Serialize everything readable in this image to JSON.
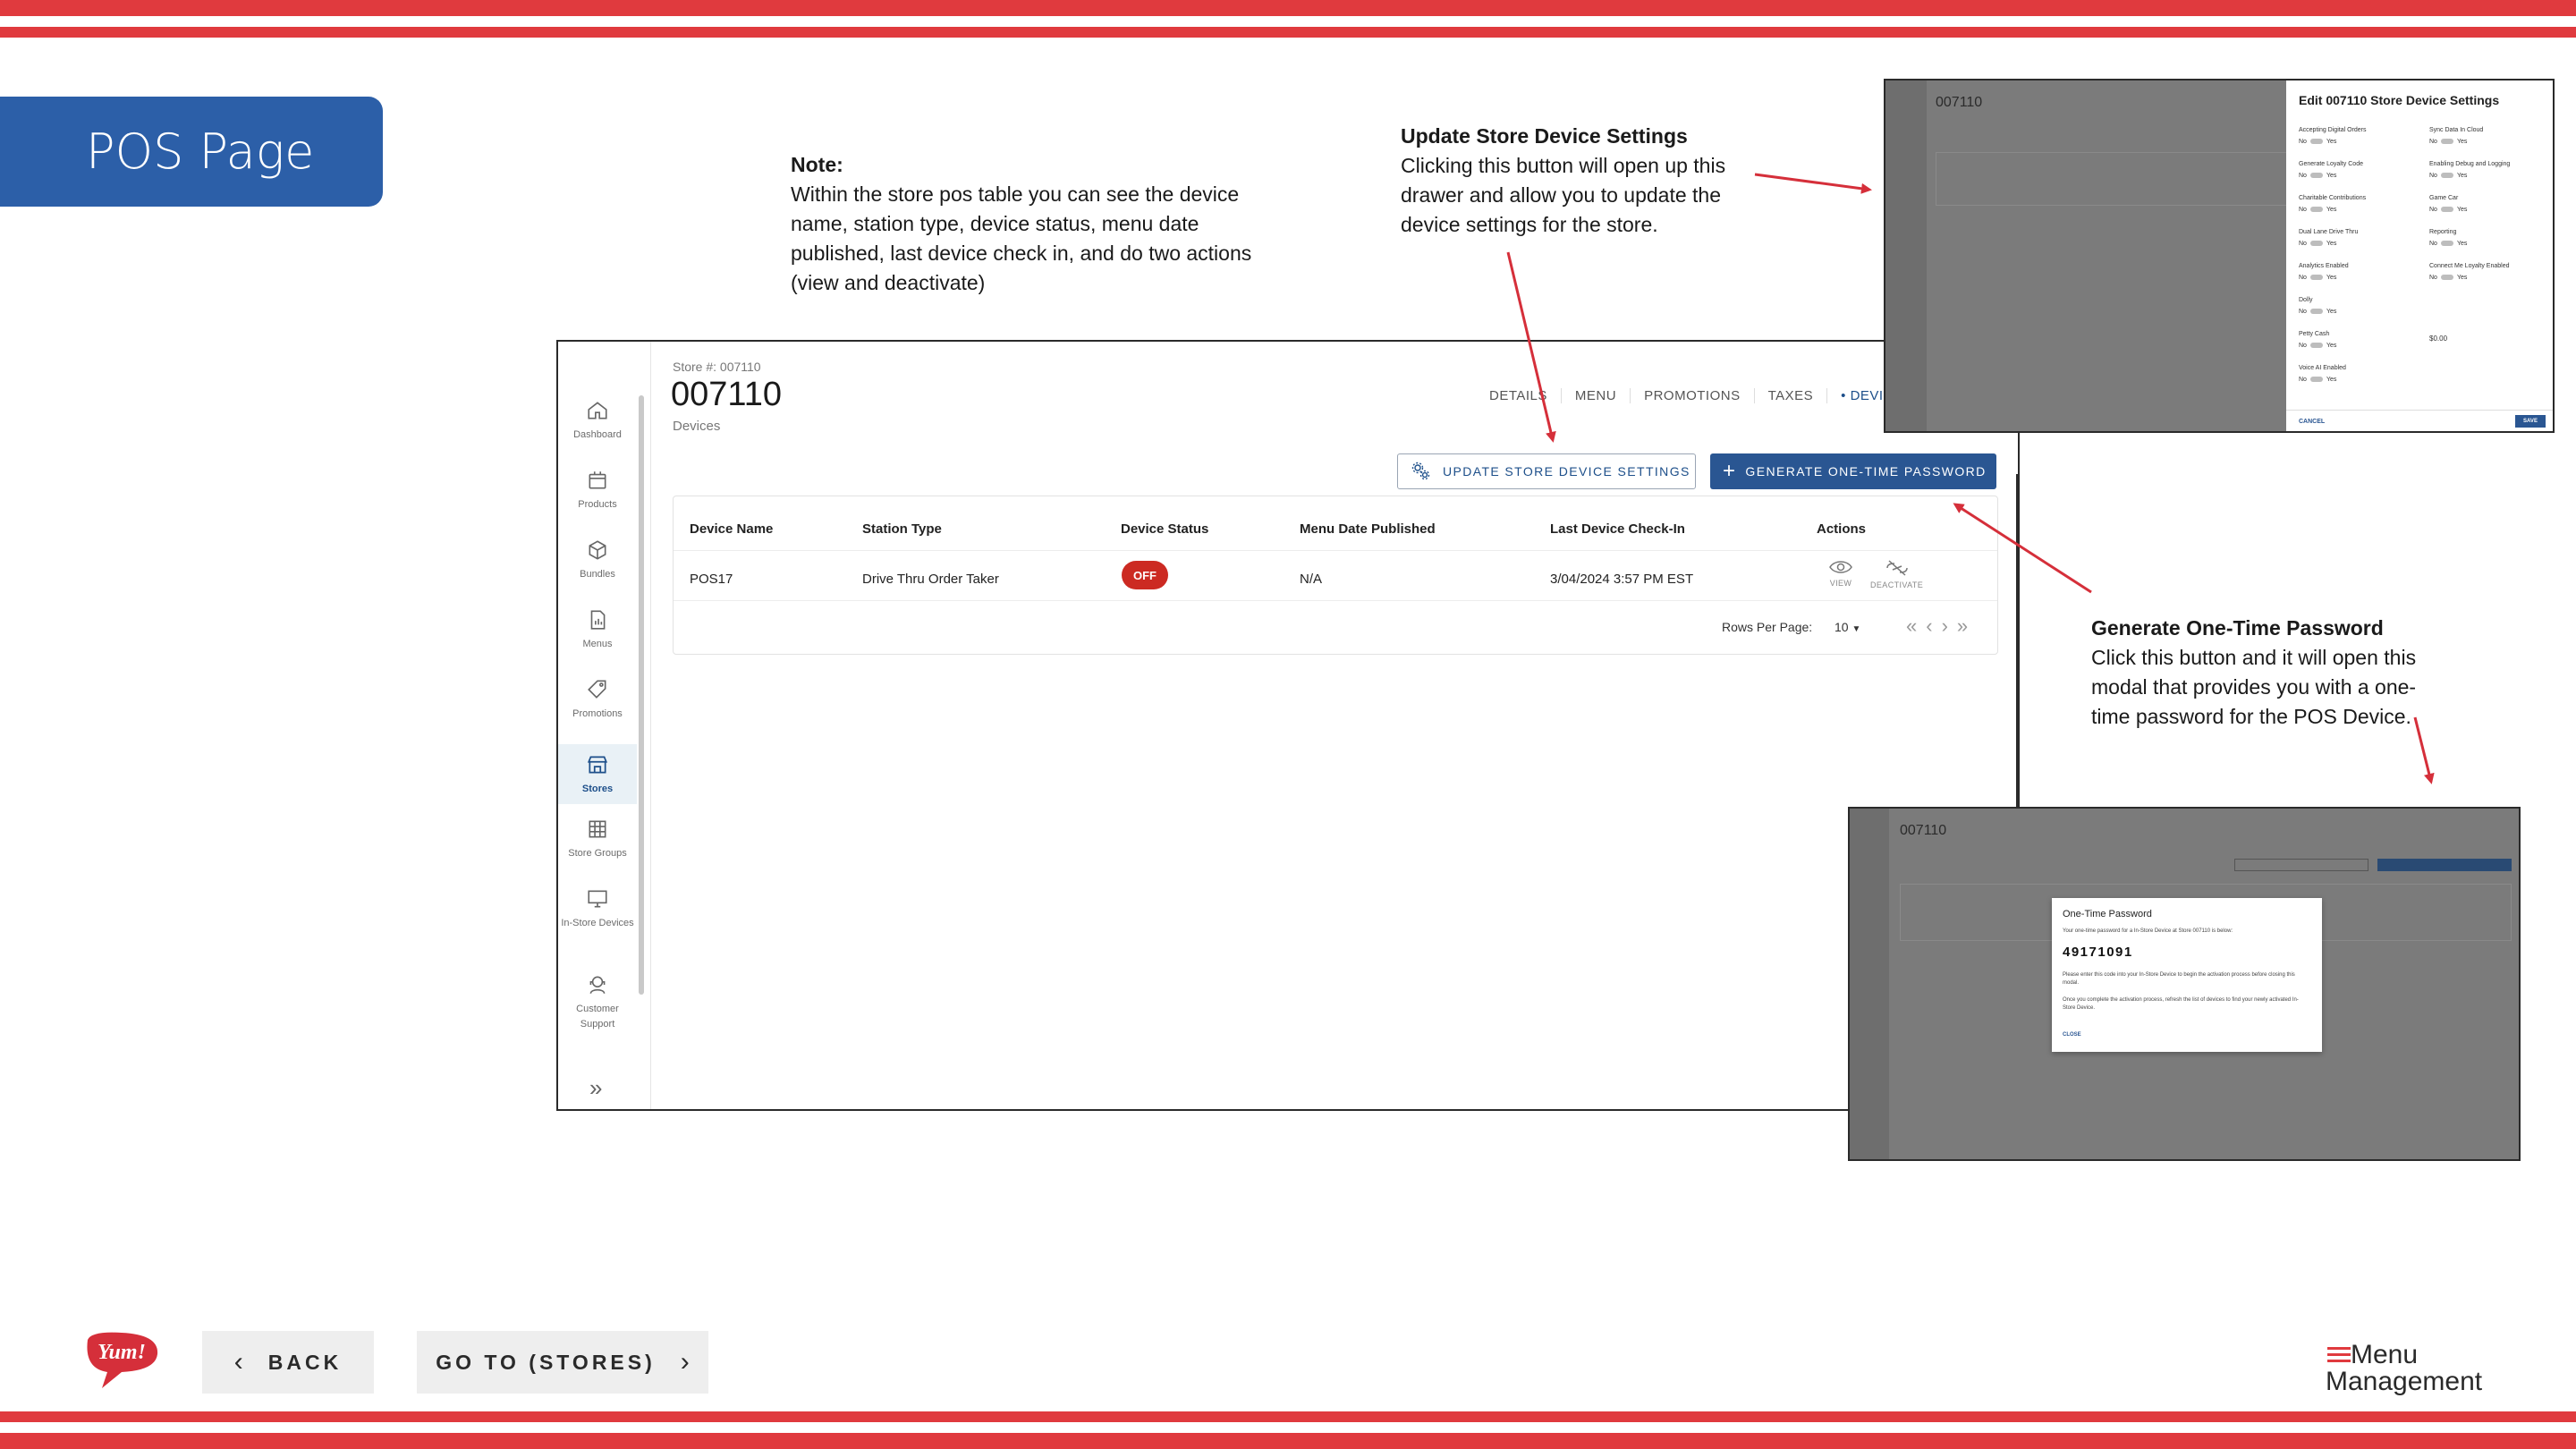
{
  "page": {
    "title": "POS Page"
  },
  "notes": {
    "main": {
      "heading": "Note:",
      "body": "Within the store pos table you can see the device name, station type, device status, menu date published, last device check in, and do two actions (view and deactivate)"
    },
    "update": {
      "heading": "Update Store Device Settings",
      "body": "Clicking this button will open up this drawer and allow you to update the device settings for the store."
    },
    "otp": {
      "heading": "Generate One-Time Password",
      "body": "Click this button and it will open this modal that provides you with a one-time password for the POS Device."
    }
  },
  "app": {
    "sidebar": [
      {
        "label": "Dashboard",
        "icon": "home-icon"
      },
      {
        "label": "Products",
        "icon": "box-icon"
      },
      {
        "label": "Bundles",
        "icon": "cube-icon"
      },
      {
        "label": "Menus",
        "icon": "document-icon"
      },
      {
        "label": "Promotions",
        "icon": "tag-icon"
      },
      {
        "label": "Stores",
        "icon": "storefront-icon"
      },
      {
        "label": "Store Groups",
        "icon": "grid-icon"
      },
      {
        "label": "In-Store Devices",
        "icon": "monitor-icon"
      },
      {
        "label": "Customer Support",
        "icon": "support-icon"
      }
    ],
    "store_number_label": "Store #: 007110",
    "store_title": "007110",
    "store_subtitle": "Devices",
    "tabs": [
      "DETAILS",
      "MENU",
      "PROMOTIONS",
      "TAXES",
      "• DEVIC"
    ],
    "update_button": "UPDATE STORE DEVICE SETTINGS",
    "generate_button": "GENERATE ONE-TIME PASSWORD",
    "table": {
      "headers": [
        "Device Name",
        "Station Type",
        "Device Status",
        "Menu Date Published",
        "Last Device Check-In",
        "Actions"
      ],
      "rows": [
        {
          "device_name": "POS17",
          "station_type": "Drive Thru Order Taker",
          "status": "OFF",
          "menu_date": "N/A",
          "last_check_in": "3/04/2024 3:57 PM EST"
        }
      ],
      "actions": {
        "view": "VIEW",
        "deactivate": "DEACTIVATE"
      },
      "rows_per_page_label": "Rows Per Page:",
      "rows_per_page_value": "10"
    }
  },
  "drawer_thumb": {
    "title": "Edit 007110 Store Device Settings",
    "store_title": "007110",
    "settings_left": [
      "Accepting Digital Orders",
      "Generate Loyalty Code",
      "Charitable Contributions",
      "Dual Lane Drive Thru",
      "Analytics Enabled",
      "Dolly",
      "Petty Cash",
      "Voice AI Enabled"
    ],
    "settings_right": [
      "Sync Data In Cloud",
      "Enabling Debug and Logging",
      "Game Car",
      "Reporting",
      "Connect Me Loyalty Enabled"
    ],
    "toggle_no": "No",
    "toggle_yes": "Yes",
    "petty_cash_value": "$0.00",
    "cancel": "CANCEL",
    "save": "SAVE"
  },
  "modal_thumb": {
    "store_title": "007110",
    "title": "One-Time Password",
    "intro": "Your one-time password for a In-Store Device at Store 007110 is below:",
    "password": "49171091",
    "instruction": "Please enter this code into your In-Store Device to begin the activation process before closing this modal.",
    "after": "Once you complete the activation process, refresh the list of devices to find your newly activated In-Store Device.",
    "close": "CLOSE"
  },
  "footer": {
    "back": "BACK",
    "goto": "GO TO (STORES)",
    "brand_logo_text": "Yum!",
    "product_logo_line1": "Menu",
    "product_logo_line2": "Management"
  },
  "colors": {
    "stripe_red": "#e03a3e",
    "tab_blue": "#2c5fa8",
    "button_blue": "#2a5692",
    "status_red": "#cc2a22"
  }
}
